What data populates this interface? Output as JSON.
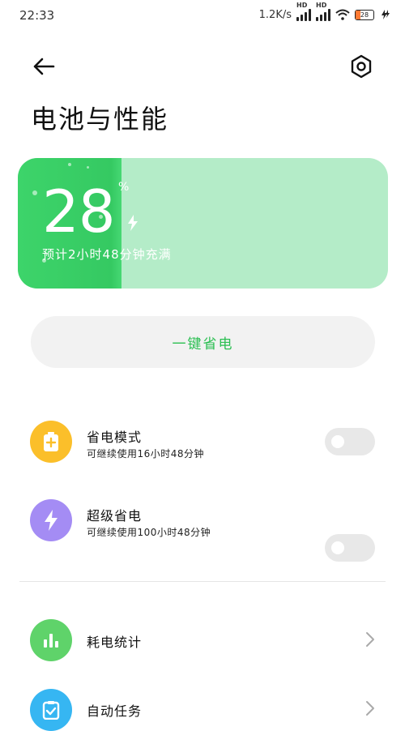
{
  "status_bar": {
    "time": "22:33",
    "speed": "1.2K/s",
    "hd": "HD",
    "battery_level": "28"
  },
  "header": {
    "title": "电池与性能"
  },
  "battery_card": {
    "percent": "28",
    "percent_sign": "%",
    "eta": "预计2小时48分钟充满",
    "level_fraction": 0.28,
    "color_fill": "#3dd46a",
    "color_track": "#b4ecc8"
  },
  "onekey": {
    "label": "一键省电"
  },
  "modes": [
    {
      "title": "省电模式",
      "subtitle": "可继续使用16小时48分钟",
      "icon": "battery-plus-icon",
      "color": "#fbbf2a",
      "enabled": false
    },
    {
      "title": "超级省电",
      "subtitle": "可继续使用100小时48分钟",
      "icon": "lightning-icon",
      "color": "#a48cf4",
      "enabled": false
    }
  ],
  "menu": [
    {
      "title": "耗电统计",
      "icon": "bar-chart-icon",
      "color": "#5fd36a"
    },
    {
      "title": "自动任务",
      "icon": "clipboard-check-icon",
      "color": "#36b6f2"
    }
  ]
}
